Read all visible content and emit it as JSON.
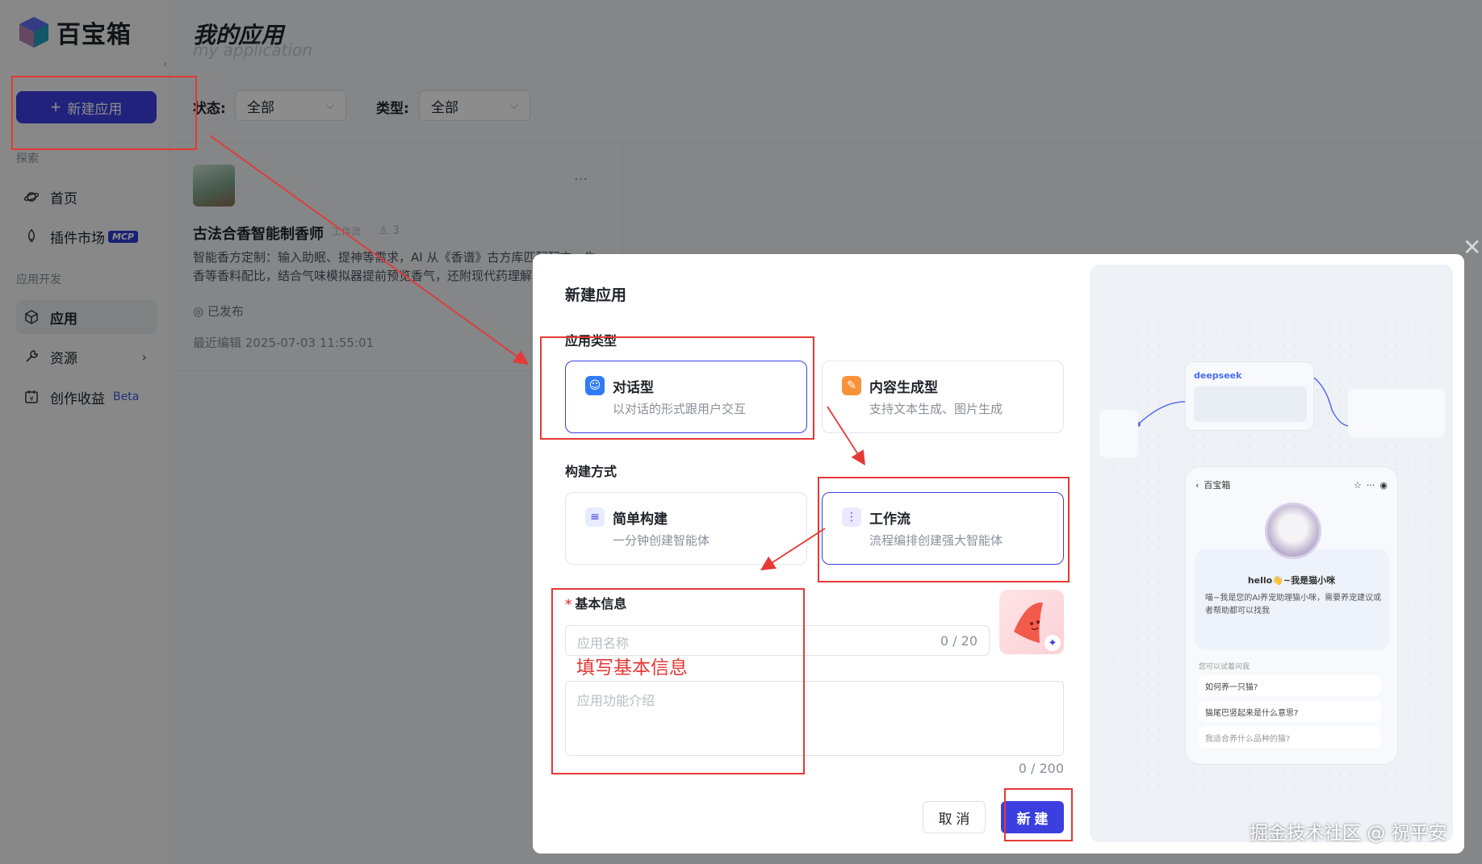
{
  "brand": {
    "name": "百宝箱"
  },
  "sidebar": {
    "new_app_label": "新建应用",
    "explore_label": "探索",
    "dev_label": "应用开发",
    "items": [
      {
        "label": "首页",
        "icon": "planet-icon"
      },
      {
        "label": "插件市场",
        "icon": "rocket-icon",
        "badge": "MCP"
      },
      {
        "label": "应用",
        "icon": "cube-icon"
      },
      {
        "label": "资源",
        "icon": "wrench-icon"
      },
      {
        "label": "创作收益",
        "icon": "calendar-money-icon",
        "badge": "Beta"
      }
    ]
  },
  "page": {
    "title": "我的应用",
    "subtitle": "my application",
    "status_label": "状态:",
    "status_value": "全部",
    "type_label": "类型:",
    "type_value": "全部"
  },
  "app_card": {
    "name": "古法合香智能制香师",
    "tag": "工作流",
    "likes": "3",
    "more": "···",
    "desc": "智能香方定制：输入助眠、提神等需求，AI 从《香谱》古方库匹配配方，生香等香料配比，结合气味模拟器提前预览香气，还附现代药理解",
    "status": "已发布",
    "last_edit": "最近编辑 2025-07-03 11:55:01"
  },
  "modal": {
    "title": "新建应用",
    "app_type_label": "应用类型",
    "app_types": [
      {
        "name": "对话型",
        "desc": "以对话的形式跟用户交互",
        "selected": true
      },
      {
        "name": "内容生成型",
        "desc": "支持文本生成、图片生成",
        "selected": false
      }
    ],
    "build_label": "构建方式",
    "build_modes": [
      {
        "name": "简单构建",
        "desc": "一分钟创建智能体",
        "selected": false
      },
      {
        "name": "工作流",
        "desc": "流程编排创建强大智能体",
        "selected": true
      }
    ],
    "basic_info_label": "基本信息",
    "name_placeholder": "应用名称",
    "name_count": "0 / 20",
    "desc_placeholder": "应用功能介绍",
    "desc_count": "0 / 200",
    "cancel_label": "取 消",
    "create_label": "新 建"
  },
  "preview": {
    "flow_brand": "deepseek",
    "phone_brand": "百宝箱",
    "hello": "hello👋~我是猫小咪",
    "intro": "喵~我是您的AI养宠助理猫小咪，需要养宠建议或者帮助都可以找我",
    "question_label": "您可以试着问我",
    "questions": [
      "如何养一只猫?",
      "猫尾巴竖起来是什么意思?",
      "我适合养什么品种的猫?"
    ]
  },
  "annotation": {
    "text": "填写基本信息"
  },
  "watermark": "掘金技术社区 @ 祝平安",
  "colors": {
    "primary": "#3b3fe0",
    "annotation": "#e53935"
  }
}
